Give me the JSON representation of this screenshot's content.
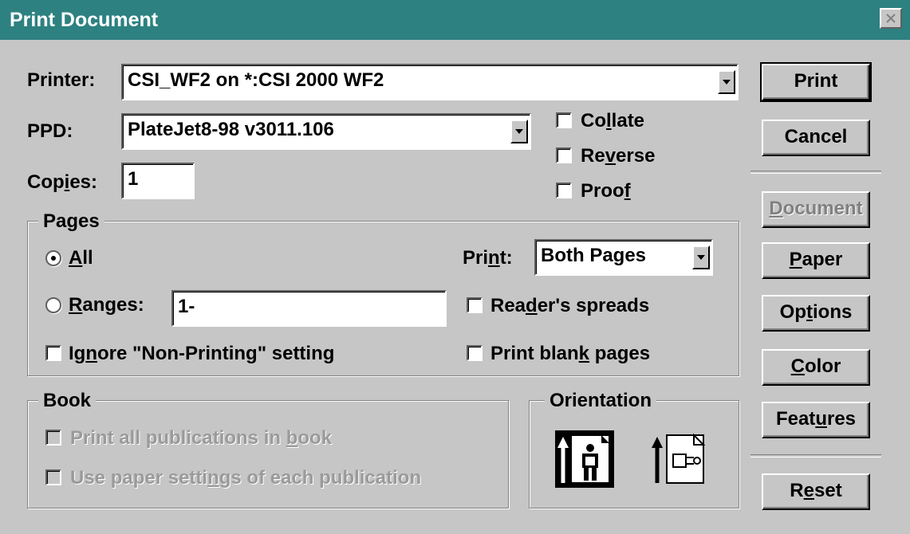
{
  "window": {
    "title": "Print Document"
  },
  "printer": {
    "label": "Printer:",
    "value": "CSI_WF2 on *:CSI 2000 WF2"
  },
  "ppd": {
    "label": "PPD:",
    "value": "PlateJet8-98 v3011.106"
  },
  "copies": {
    "label_pre": "Cop",
    "label_u": "i",
    "label_post": "es:",
    "value": "1"
  },
  "checks_top": {
    "collate": {
      "pre": "Co",
      "u": "l",
      "post": "late"
    },
    "reverse": {
      "pre": "Re",
      "u": "v",
      "post": "erse"
    },
    "proof": {
      "pre": "Proo",
      "u": "f",
      "post": ""
    }
  },
  "pages": {
    "group_label": "Pages",
    "all": {
      "pre": "",
      "u": "A",
      "post": "ll",
      "selected": true
    },
    "ranges": {
      "pre": "",
      "u": "R",
      "post": "anges:",
      "value": "1-"
    },
    "ignore": {
      "pre": "Ig",
      "u": "n",
      "post": "ore \"Non-Printing\" setting"
    },
    "print_label": {
      "pre": "Pri",
      "u": "n",
      "post": "t:"
    },
    "print_value": "Both Pages",
    "readers": {
      "pre": "Rea",
      "u": "d",
      "post": "er's spreads"
    },
    "blank": {
      "pre": "Print blan",
      "u": "k",
      "post": " pages"
    }
  },
  "book": {
    "group_label": "Book",
    "all_pubs": {
      "pre": "Print all publications in ",
      "u": "b",
      "post": "ook"
    },
    "paper_settings": {
      "pre": "Use paper setti",
      "u": "n",
      "post": "gs of each publication"
    }
  },
  "orientation": {
    "group_label": "Orientation",
    "portrait_icon": "portrait-orientation-icon",
    "landscape_icon": "landscape-orientation-icon"
  },
  "buttons": {
    "print": "Print",
    "cancel": "Cancel",
    "document": {
      "pre": "",
      "u": "D",
      "post": "ocument"
    },
    "paper": {
      "pre": "",
      "u": "P",
      "post": "aper"
    },
    "options": {
      "pre": "Op",
      "u": "t",
      "post": "ions"
    },
    "color": {
      "pre": "",
      "u": "C",
      "post": "olor"
    },
    "features": {
      "pre": "Feat",
      "u": "u",
      "post": "res"
    },
    "reset": {
      "pre": "R",
      "u": "e",
      "post": "set"
    }
  },
  "colors": {
    "titlebar": "#2d8181",
    "face": "#c6c6c6"
  }
}
